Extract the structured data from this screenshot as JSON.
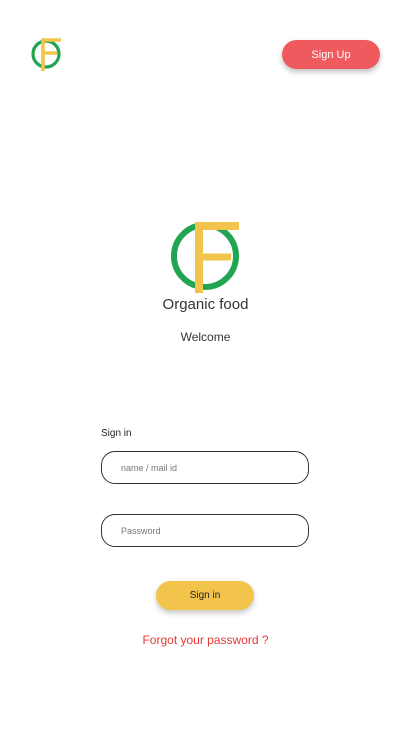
{
  "header": {
    "logo_icon": "organic-food-logo-icon",
    "signup_label": "Sign Up"
  },
  "brand": {
    "logo_icon": "organic-food-logo-icon",
    "name": "Organic food",
    "welcome": "Welcome"
  },
  "form": {
    "title": "Sign in",
    "username_placeholder": "name / mail id",
    "password_placeholder": "Password",
    "submit_label": "Sign in",
    "forgot_label": "Forgot your password ?"
  },
  "colors": {
    "logo_green": "#21a552",
    "logo_yellow": "#f3c44b",
    "signup_red": "#ee5a5d",
    "signin_yellow": "#f3c44b",
    "forgot_red": "#e53935"
  }
}
